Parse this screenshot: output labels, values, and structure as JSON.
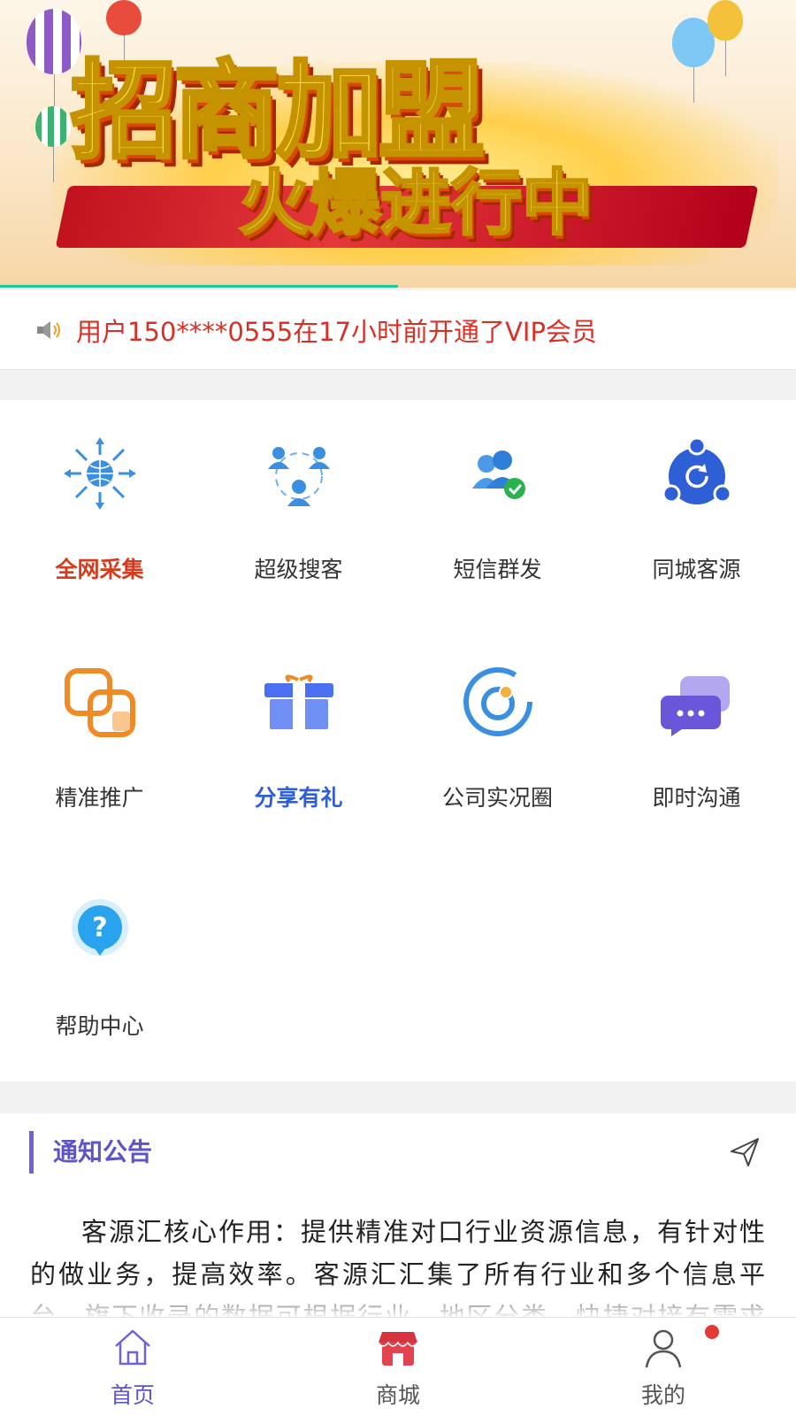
{
  "banner": {
    "line1": "招商加盟",
    "line2": "火爆进行中"
  },
  "notice": {
    "text": "用户150****0555在17小时前开通了VIP会员",
    "icon": "speaker-icon"
  },
  "grid": {
    "items": [
      {
        "label": "全网采集",
        "icon": "globe-network-icon"
      },
      {
        "label": "超级搜客",
        "icon": "people-connect-icon"
      },
      {
        "label": "短信群发",
        "icon": "group-check-icon"
      },
      {
        "label": "同城客源",
        "icon": "circle-refresh-icon"
      },
      {
        "label": "精准推广",
        "icon": "overlap-squares-icon"
      },
      {
        "label": "分享有礼",
        "icon": "gift-box-icon"
      },
      {
        "label": "公司实况圈",
        "icon": "camera-lens-icon"
      },
      {
        "label": "即时沟通",
        "icon": "chat-bubble-icon"
      },
      {
        "label": "帮助中心",
        "icon": "help-bubble-icon"
      }
    ]
  },
  "announcement": {
    "title": "通知公告",
    "body": "客源汇核心作用：提供精准对口行业资源信息，有针对性的做业务，提高效率。客源汇汇集了所有行业和多个信息平台，旗下收录的数据可根据行业、地区分类，快捷对接有需求的精准客户资源。"
  },
  "tabbar": {
    "tabs": [
      {
        "label": "首页",
        "icon": "home-icon"
      },
      {
        "label": "商城",
        "icon": "shop-icon"
      },
      {
        "label": "我的",
        "icon": "user-icon"
      }
    ]
  },
  "colors": {
    "accent": "#5b55c9",
    "notice_red": "#d93025",
    "active_red": "#d63a1d",
    "active_blue": "#2f5fd6",
    "badge_red": "#e53935"
  }
}
